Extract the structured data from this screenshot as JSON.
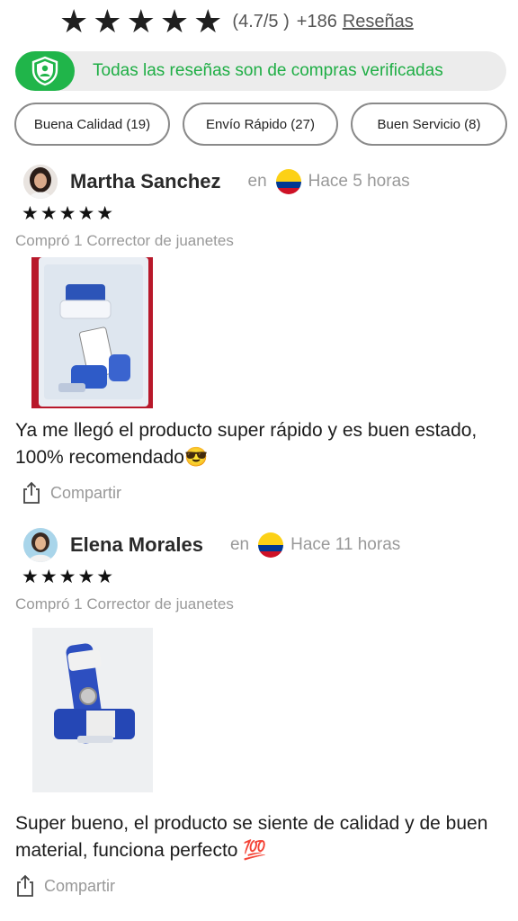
{
  "summary": {
    "stars": "★ ★ ★ ★ ★",
    "score": "(4.7/5 )",
    "count": "+186",
    "reviews_link": "Reseñas"
  },
  "verified": {
    "text": "Todas las reseñas son de compras verificadas",
    "color": "#20b54a"
  },
  "chips": [
    {
      "label": "Buena Calidad (19)"
    },
    {
      "label": "Envío Rápido (27)"
    },
    {
      "label": "Buen Servicio (8)"
    }
  ],
  "reviews": [
    {
      "author": "Martha Sanchez",
      "en": "en",
      "country": "Colombia",
      "time": "Hace 5 horas",
      "stars": "★★★★★",
      "bought": "Compró 1 Corrector de juanetes",
      "text": "Ya me llegó el producto super rápido y es buen estado, 100% recomendado😎",
      "share": "Compartir"
    },
    {
      "author": "Elena Morales",
      "en": "en",
      "country": "Colombia",
      "time": "Hace 11 horas",
      "stars": "★★★★★",
      "bought": "Compró 1 Corrector de juanetes",
      "text": "Super bueno, el producto se siente de calidad y de buen material, funciona perfecto 💯",
      "share": "Compartir"
    }
  ],
  "colors": {
    "accent_green": "#20b54a",
    "flag_yellow": "#fcd116",
    "flag_blue": "#003893",
    "flag_red": "#ce1126"
  }
}
